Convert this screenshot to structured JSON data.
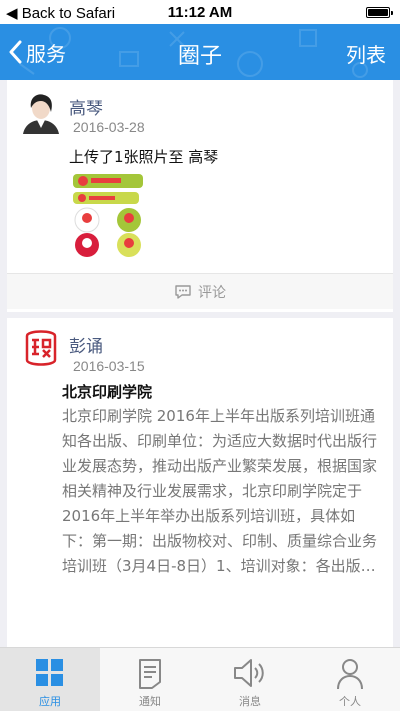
{
  "status_bar": {
    "back_label": "Back to Safari",
    "time": "11:12 AM"
  },
  "nav": {
    "back_label": "服务",
    "title": "圈子",
    "right_label": "列表"
  },
  "posts": [
    {
      "author": "高琴",
      "date": "2016-03-28",
      "content": "上传了1张照片至 高琴",
      "comment_label": "评论"
    },
    {
      "author": "彭诵",
      "date": "2016-03-15",
      "title": "北京印刷学院",
      "body": "北京印刷学院 2016年上半年出版系列培训班通知各出版、印刷单位：为适应大数据时代出版行业发展态势，推动出版产业繁荣发展，根据国家相关精神及行业发展需求，北京印刷学院定于2016年上半年举办出版系列培训班，具体如下：第一期：出版物校对、印制、质量综合业务培训班（3月4日-8日）1、培训对象：各出版…"
    }
  ],
  "tabs": [
    {
      "label": "应用",
      "icon": "apps-grid-icon",
      "active": true
    },
    {
      "label": "通知",
      "icon": "notice-doc-icon",
      "active": false
    },
    {
      "label": "消息",
      "icon": "speaker-icon",
      "active": false
    },
    {
      "label": "个人",
      "icon": "person-icon",
      "active": false
    }
  ],
  "colors": {
    "accent": "#2a8fe3",
    "author_name": "#4a5a7f"
  }
}
